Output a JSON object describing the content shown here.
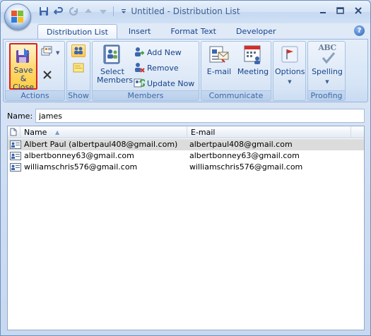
{
  "window": {
    "title": "Untitled - Distribution List"
  },
  "tabs": [
    {
      "label": "Distribution List",
      "active": true
    },
    {
      "label": "Insert",
      "active": false
    },
    {
      "label": "Format Text",
      "active": false
    },
    {
      "label": "Developer",
      "active": false
    }
  ],
  "ribbon": {
    "actions": {
      "label": "Actions",
      "save_close_line1": "Save &",
      "save_close_line2": "Close"
    },
    "show": {
      "label": "Show"
    },
    "members": {
      "label": "Members",
      "select_members_line1": "Select",
      "select_members_line2": "Members",
      "add_new": "Add New",
      "remove": "Remove",
      "update_now": "Update Now"
    },
    "communicate": {
      "label": "Communicate",
      "email": "E-mail",
      "meeting": "Meeting"
    },
    "options": {
      "label": "Options"
    },
    "proofing": {
      "label": "Proofing",
      "spelling": "Spelling",
      "abc": "ABC"
    }
  },
  "name_field": {
    "label": "Name:",
    "value": "james"
  },
  "list": {
    "columns": [
      "Name",
      "E-mail"
    ],
    "rows": [
      {
        "name": "Albert Paul (albertpaul408@gmail.com)",
        "email": "albertpaul408@gmail.com"
      },
      {
        "name": "albertbonney63@gmail.com",
        "email": "albertbonney63@gmail.com"
      },
      {
        "name": "williamschris576@gmail.com",
        "email": "williamschris576@gmail.com"
      }
    ]
  },
  "colors": {
    "accent": "#15428b",
    "highlight_border": "#e0201b",
    "selected_row": "#dcdcdc"
  }
}
